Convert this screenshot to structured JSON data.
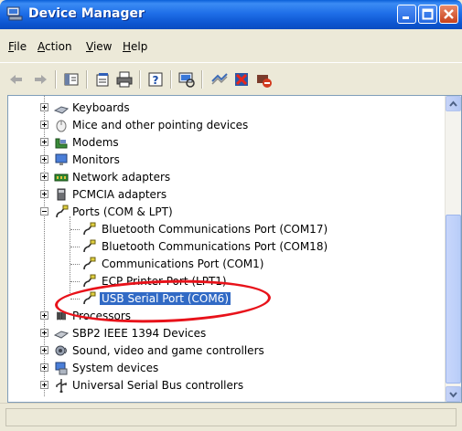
{
  "window": {
    "title": "Device Manager",
    "icon": "device-manager-icon"
  },
  "menu": [
    {
      "label": "File",
      "u": "F",
      "rest": "ile"
    },
    {
      "label": "Action",
      "u": "A",
      "rest": "ction"
    },
    {
      "label": "View",
      "u": "V",
      "rest": "iew"
    },
    {
      "label": "Help",
      "u": "H",
      "rest": "elp"
    }
  ],
  "toolbar": [
    "back-icon",
    "forward-icon",
    "show-hide-console-tree-icon",
    "properties-icon",
    "print-icon",
    "help-icon",
    "scan-hardware-icon",
    "update-driver-icon",
    "disable-device-icon",
    "uninstall-device-icon"
  ],
  "tree": {
    "items": [
      {
        "label": "Keyboards",
        "icon": "keyboard-icon",
        "expanded": false
      },
      {
        "label": "Mice and other pointing devices",
        "icon": "mouse-icon",
        "expanded": false
      },
      {
        "label": "Modems",
        "icon": "modem-icon",
        "expanded": false
      },
      {
        "label": "Monitors",
        "icon": "monitor-icon",
        "expanded": false
      },
      {
        "label": "Network adapters",
        "icon": "network-adapter-icon",
        "expanded": false
      },
      {
        "label": "PCMCIA adapters",
        "icon": "pcmcia-icon",
        "expanded": false
      },
      {
        "label": "Ports (COM & LPT)",
        "icon": "port-icon",
        "expanded": true
      },
      {
        "label": "Bluetooth Communications Port (COM17)",
        "icon": "port-icon",
        "child": true
      },
      {
        "label": "Bluetooth Communications Port (COM18)",
        "icon": "port-icon",
        "child": true
      },
      {
        "label": "Communications Port (COM1)",
        "icon": "port-icon",
        "child": true
      },
      {
        "label": "ECP Printer Port (LPT1)",
        "icon": "port-icon",
        "child": true
      },
      {
        "label": "USB Serial Port (COM6)",
        "icon": "port-icon",
        "child": true,
        "selected": true
      },
      {
        "label": "Processors",
        "icon": "processor-icon",
        "expanded": false
      },
      {
        "label": "SBP2 IEEE 1394 Devices",
        "icon": "ieee1394-icon",
        "expanded": false
      },
      {
        "label": "Sound, video and game controllers",
        "icon": "sound-icon",
        "expanded": false
      },
      {
        "label": "System devices",
        "icon": "system-device-icon",
        "expanded": false
      },
      {
        "label": "Universal Serial Bus controllers",
        "icon": "usb-icon",
        "expanded": false
      }
    ]
  },
  "status_text": "",
  "colors": {
    "selection": "#316ac5",
    "highlight_ellipse": "#e8121a",
    "titlebar": "#0c55d0"
  }
}
